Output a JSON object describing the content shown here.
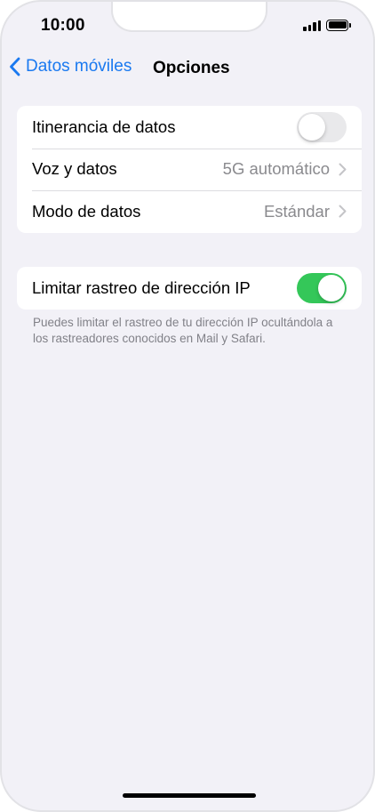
{
  "status_bar": {
    "time": "10:00",
    "signal_icon": "cellular-signal-icon",
    "battery_icon": "battery-full-icon"
  },
  "nav": {
    "back_label": "Datos móviles",
    "back_icon": "chevron-left-icon",
    "title": "Opciones",
    "accent_color": "#1a79f0"
  },
  "section1": {
    "rows": [
      {
        "label": "Itinerancia de datos",
        "type": "toggle",
        "toggle_on": false
      },
      {
        "label": "Voz y datos",
        "type": "disclosure",
        "value": "5G automático"
      },
      {
        "label": "Modo de datos",
        "type": "disclosure",
        "value": "Estándar"
      }
    ]
  },
  "section2": {
    "rows": [
      {
        "label": "Limitar rastreo de dirección IP",
        "type": "toggle",
        "toggle_on": true
      }
    ],
    "footnote": "Puedes limitar el rastreo de tu dirección IP ocultándola a los rastreadores conocidos en Mail y Safari."
  },
  "colors": {
    "toggle_on": "#34c759",
    "toggle_off": "#e9e9eb",
    "background": "#f2f1f7"
  }
}
